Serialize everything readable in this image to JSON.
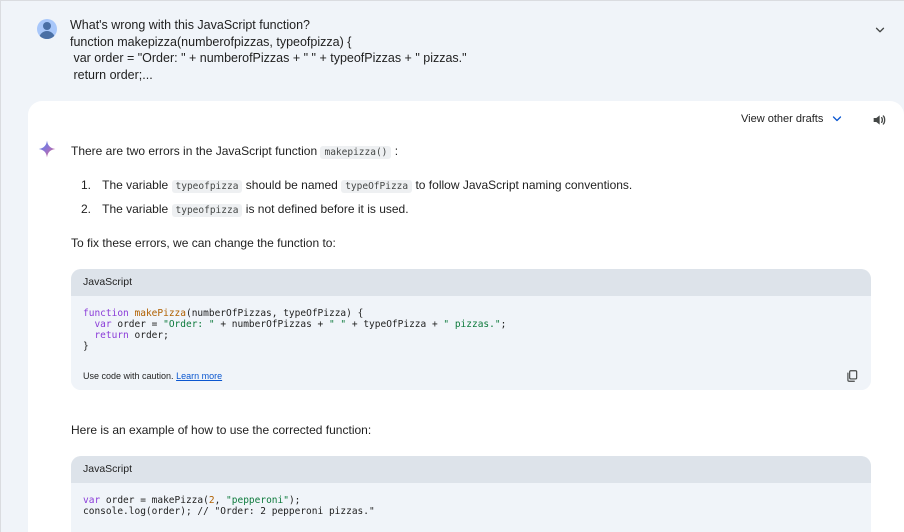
{
  "prompt": {
    "lines": [
      "What's wrong with this JavaScript function?",
      "function makepizza(numberofpizzas, typeofpizza) {",
      " var order = \"Order: \" + numberofPizzas + \" \" + typeofPizzas + \" pizzas.\"",
      " return order;..."
    ]
  },
  "toolbar": {
    "view_drafts_label": "View other drafts"
  },
  "response": {
    "intro_prefix": "There are two errors in the JavaScript function",
    "intro_code": "makepizza()",
    "intro_suffix": ":",
    "items": [
      {
        "num": "1.",
        "prefix": "The variable",
        "code1": "typeofpizza",
        "mid": "should be named",
        "code2": "typeOfPizza",
        "suffix": "to follow JavaScript naming conventions."
      },
      {
        "num": "2.",
        "prefix": "The variable",
        "code1": "typeofpizza",
        "suffix": "is not defined before it is used."
      }
    ],
    "fix_text": "To fix these errors, we can change the function to:",
    "example_text": "Here is an example of how to use the corrected function:"
  },
  "code_blocks": [
    {
      "language": "JavaScript",
      "caution": "Use code with caution.",
      "learn_more": "Learn more"
    },
    {
      "language": "JavaScript"
    }
  ],
  "colors": {
    "accent": "#0b57d0",
    "keyword": "#8a3bd8",
    "string": "#0d7a3c",
    "function_name": "#b06000",
    "header_bg": "#f0f4f9",
    "code_header_bg": "#dde3ea"
  },
  "icons": [
    "user-avatar-icon",
    "chevron-down-icon",
    "speaker-icon",
    "gemini-sparkle-icon",
    "copy-icon"
  ]
}
